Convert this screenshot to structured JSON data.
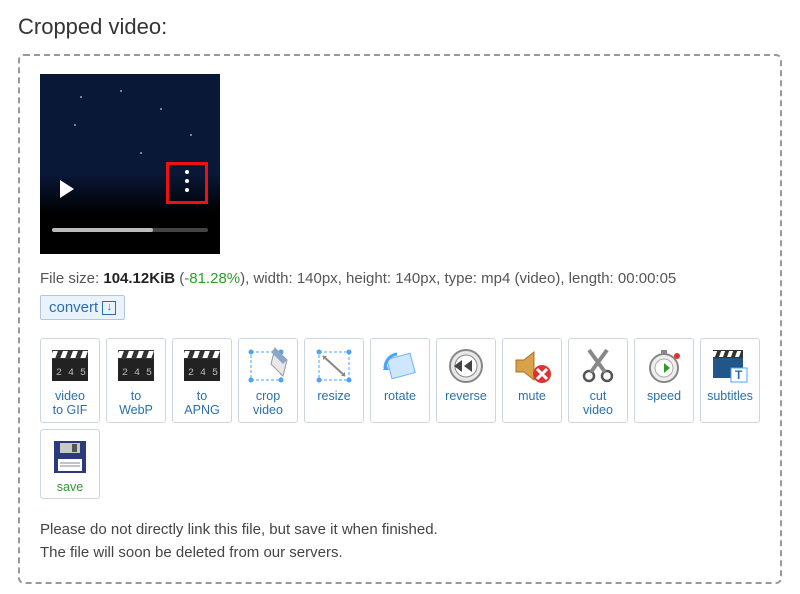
{
  "title": "Cropped video:",
  "video": {
    "play_icon_name": "play-icon",
    "menu_icon_name": "more-menu-icon"
  },
  "info": {
    "filesize_label": "File size: ",
    "filesize_value": "104.12KiB",
    "percent_change": "-81.28%",
    "width_label": ", width: ",
    "width_value": "140px",
    "height_label": ", height: ",
    "height_value": "140px",
    "type_label": ", type: ",
    "type_value": "mp4 (video)",
    "length_label": ", length: ",
    "length_value": "00:00:05"
  },
  "convert_label": "convert",
  "tools": [
    {
      "id": "video-to-gif",
      "label": "video\nto GIF"
    },
    {
      "id": "to-webp",
      "label": "to\nWebP"
    },
    {
      "id": "to-apng",
      "label": "to\nAPNG"
    },
    {
      "id": "crop-video",
      "label": "crop\nvideo"
    },
    {
      "id": "resize",
      "label": "resize"
    },
    {
      "id": "rotate",
      "label": "rotate"
    },
    {
      "id": "reverse",
      "label": "reverse"
    },
    {
      "id": "mute",
      "label": "mute"
    },
    {
      "id": "cut-video",
      "label": "cut\nvideo"
    },
    {
      "id": "speed",
      "label": "speed"
    },
    {
      "id": "subtitles",
      "label": "subtitles"
    },
    {
      "id": "save",
      "label": "save"
    }
  ],
  "notes": {
    "line1": "Please do not directly link this file, but save it when finished.",
    "line2": "The file will soon be deleted from our servers."
  }
}
